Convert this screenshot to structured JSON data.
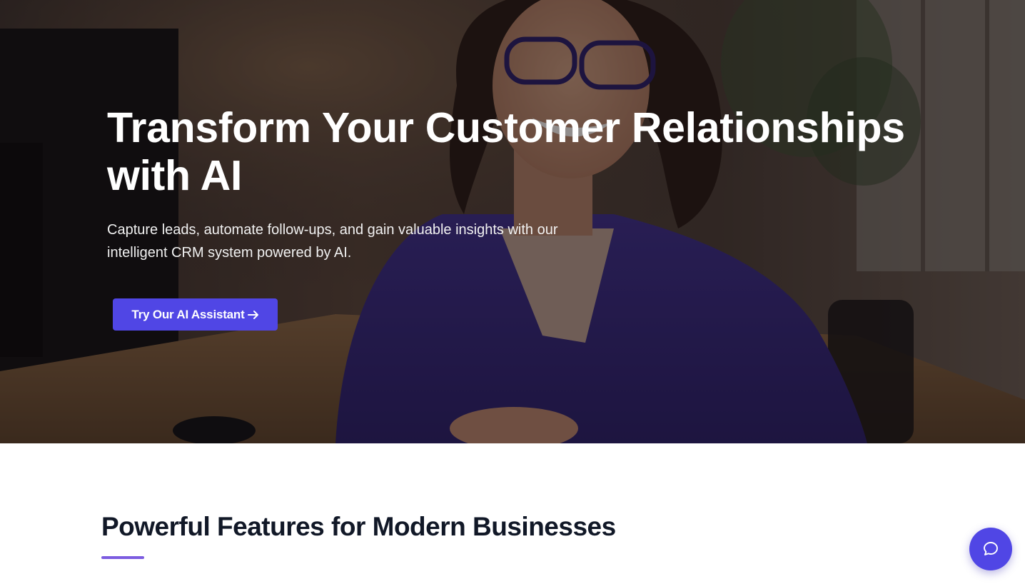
{
  "hero": {
    "title_line1": "Transform Your Customer Relationships",
    "title_line2": "with AI",
    "subtitle_line1": "Capture leads, automate follow-ups, and gain valuable insights with our",
    "subtitle_line2": "intelligent CRM system powered by AI.",
    "cta_label": "Try Our AI Assistant",
    "cta_icon": "arrow-right-icon",
    "background_image": "smiling-woman-at-desk-photo"
  },
  "features": {
    "title": "Powerful Features for Modern Businesses"
  },
  "chat_widget": {
    "icon": "chat-bubble-icon"
  },
  "colors": {
    "accent": "#5046e5",
    "underline": "#7c5ce0",
    "heading_dark": "#111827"
  }
}
